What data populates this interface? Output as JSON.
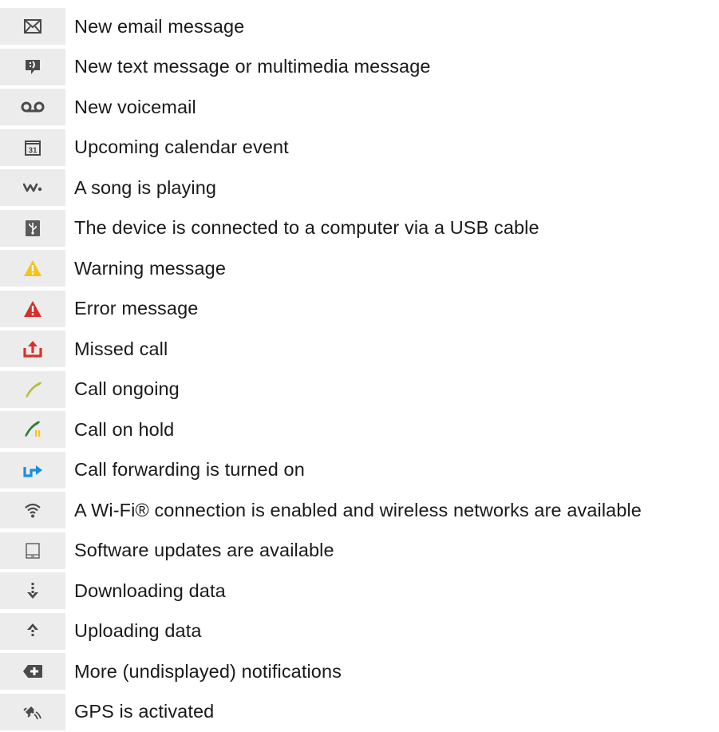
{
  "notifications": [
    {
      "icon": "email-icon",
      "text": "New email message"
    },
    {
      "icon": "text-message-icon",
      "text": "New text message or multimedia message"
    },
    {
      "icon": "voicemail-icon",
      "text": "New voicemail"
    },
    {
      "icon": "calendar-icon",
      "text": "Upcoming calendar event",
      "icon_label": "31"
    },
    {
      "icon": "walkman-icon",
      "text": "A song is playing"
    },
    {
      "icon": "usb-icon",
      "text": "The device is connected to a computer via a USB cable"
    },
    {
      "icon": "warning-icon",
      "text": "Warning message"
    },
    {
      "icon": "error-icon",
      "text": "Error message"
    },
    {
      "icon": "missed-call-icon",
      "text": "Missed call"
    },
    {
      "icon": "call-ongoing-icon",
      "text": "Call ongoing"
    },
    {
      "icon": "call-hold-icon",
      "text": "Call on hold"
    },
    {
      "icon": "call-forwarding-icon",
      "text": "Call forwarding is turned on"
    },
    {
      "icon": "wifi-icon",
      "text": "A Wi-Fi® connection is enabled and wireless networks are available"
    },
    {
      "icon": "software-update-icon",
      "text": "Software updates are available"
    },
    {
      "icon": "download-icon",
      "text": "Downloading data"
    },
    {
      "icon": "upload-icon",
      "text": "Uploading data"
    },
    {
      "icon": "more-notifications-icon",
      "text": "More (undisplayed) notifications"
    },
    {
      "icon": "gps-icon",
      "text": "GPS is activated"
    }
  ],
  "colors": {
    "icon_gray": "#4a4a4a",
    "warning_yellow": "#f6c319",
    "error_red": "#d4302b",
    "missed_call_red": "#d8322c",
    "call_ongoing_green": "#b8bf3a",
    "call_hold_green": "#2e7d32",
    "forwarding_blue": "#1a8fd6",
    "cell_background": "#ececec"
  }
}
